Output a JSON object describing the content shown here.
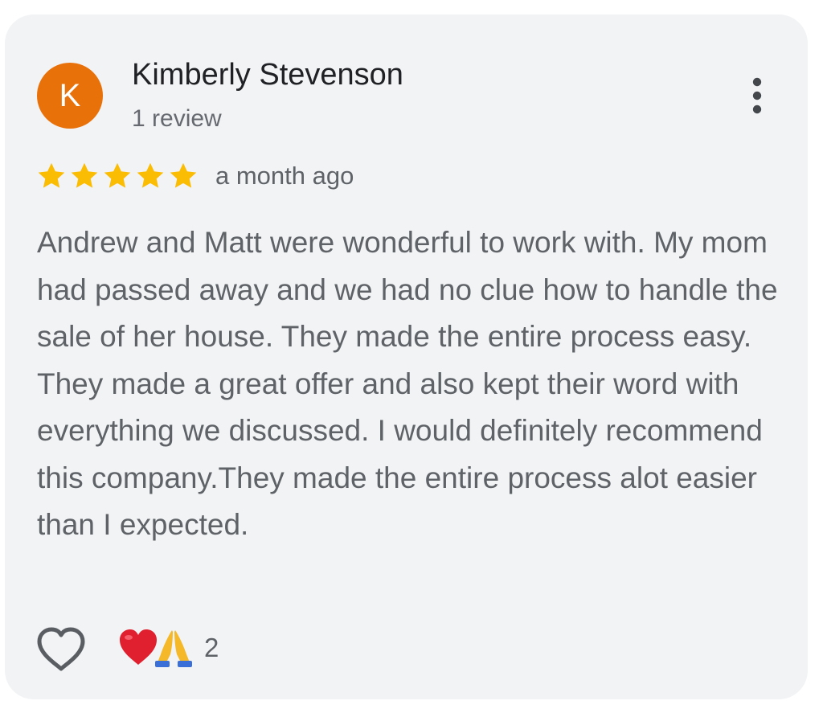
{
  "reviewer": {
    "initial": "K",
    "avatar_color": "#e8710a",
    "name": "Kimberly Stevenson",
    "review_count": "1 review"
  },
  "review": {
    "rating": 5,
    "star_color": "#fbbc04",
    "time": "a month ago",
    "text": "Andrew and Matt were wonderful to work with. My mom had passed away and we had no clue how to handle the sale of her house. They made the entire process easy. They made a great offer and also kept their word with everything we discussed. I would definitely recommend this company.They made the entire process alot easier than I expected."
  },
  "actions": {
    "like_icon": "heart-outline-icon",
    "more_icon": "more-vertical-icon",
    "reactions": [
      "red-heart",
      "folded-hands"
    ],
    "reaction_count": "2"
  }
}
